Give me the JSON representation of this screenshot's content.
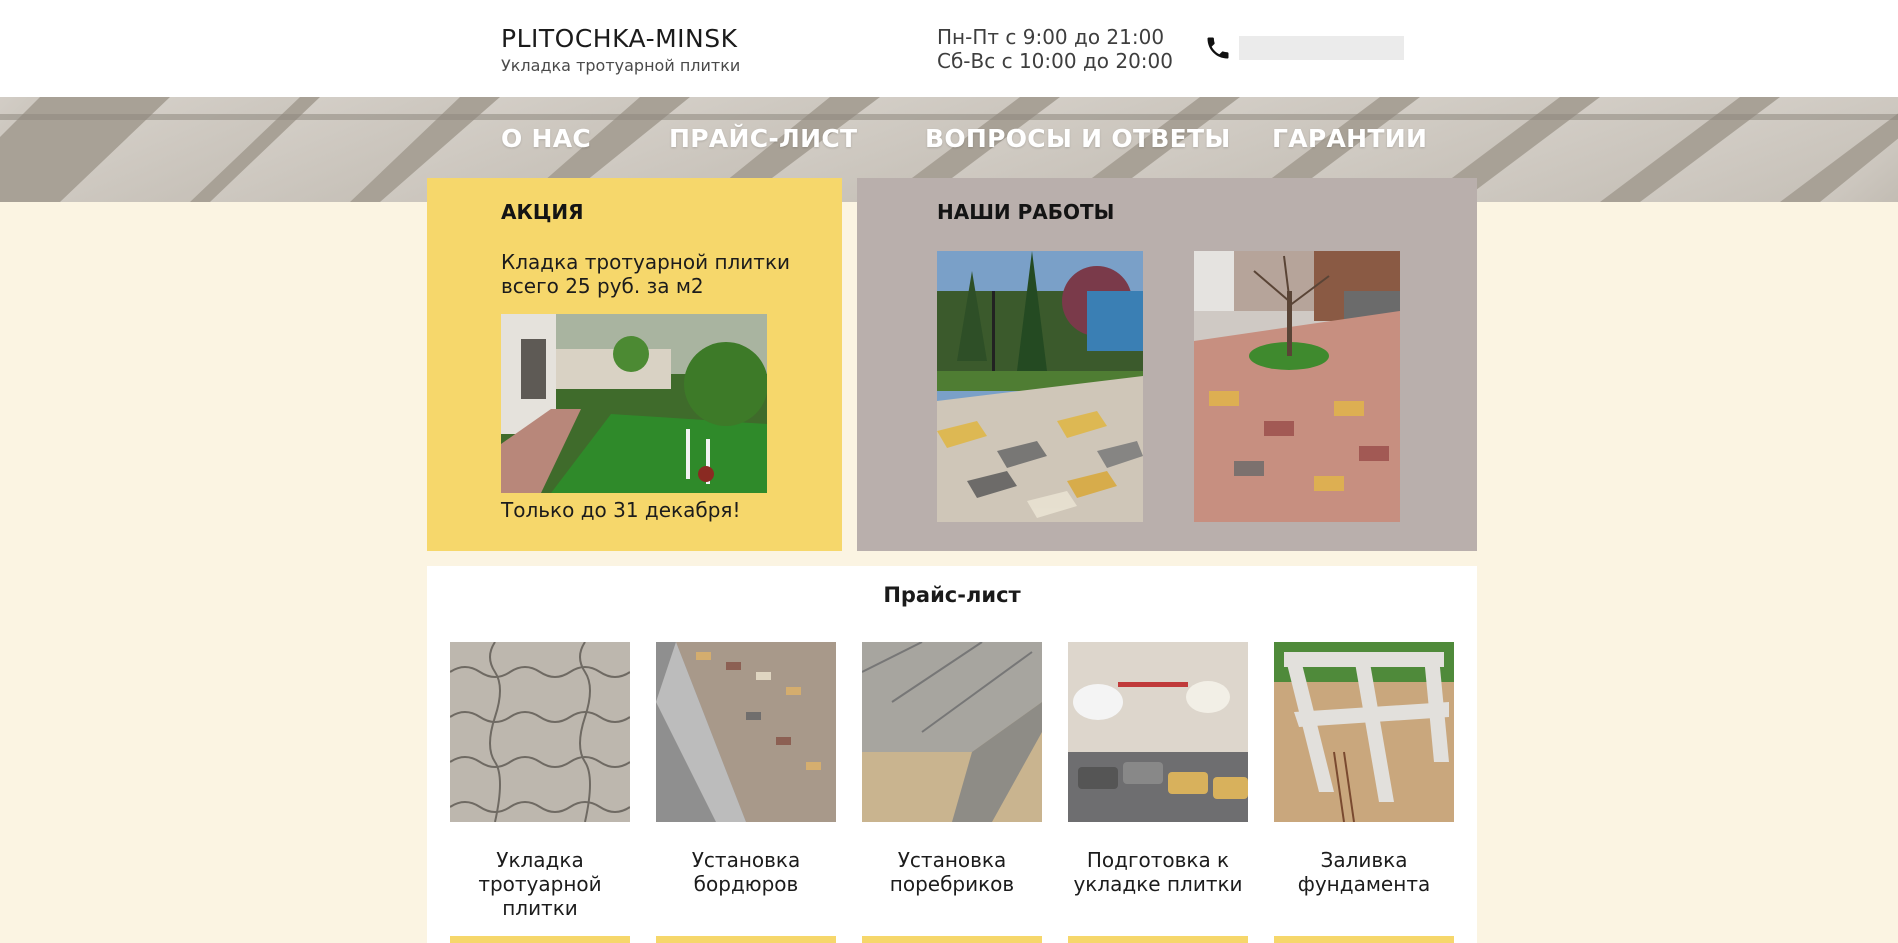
{
  "header": {
    "brand": "PLITOCHKA-MINSK",
    "subtitle": "Укладка тротуарной плитки",
    "hours_weekdays": "Пн-Пт с 9:00 до 21:00",
    "hours_weekend": "Сб-Вс с 10:00 до 20:00",
    "phone_icon": "phone-icon",
    "phone_value": ""
  },
  "nav": {
    "items": [
      {
        "label": "О НАС"
      },
      {
        "label": "ПРАЙС-ЛИСТ"
      },
      {
        "label": "ВОПРОСЫ И ОТВЕТЫ"
      },
      {
        "label": "ГАРАНТИИ"
      }
    ]
  },
  "promo": {
    "title": "АКЦИЯ",
    "text_line1": "Кладка тротуарной плитки",
    "text_line2": "всего 25 руб. за м2",
    "until": "Только до 31 декабря!"
  },
  "works": {
    "title": "НАШИ РАБОТЫ"
  },
  "pricelist": {
    "title": "Прайс-лист",
    "services": [
      {
        "line1": "Укладка",
        "line2": "тротуарной",
        "line3": "плитки"
      },
      {
        "line1": "Установка",
        "line2": "бордюров",
        "line3": ""
      },
      {
        "line1": "Установка",
        "line2": "поребриков",
        "line3": ""
      },
      {
        "line1": "Подготовка к",
        "line2": "укладке плитки",
        "line3": ""
      },
      {
        "line1": "Заливка",
        "line2": "фундамента",
        "line3": ""
      }
    ]
  },
  "colors": {
    "background": "#fbf4e2",
    "accent_yellow": "#f6d76b",
    "works_panel": "#b9afac",
    "header_bg": "#ffffff"
  }
}
